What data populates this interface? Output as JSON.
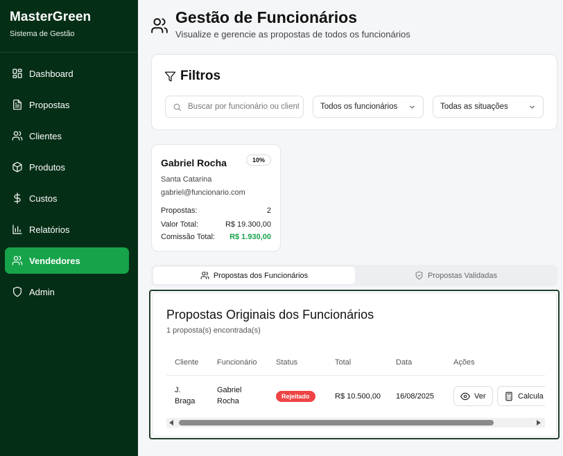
{
  "brand": {
    "title": "MasterGreen",
    "subtitle": "Sistema de Gestão"
  },
  "sidebar": {
    "items": [
      {
        "label": "Dashboard",
        "icon": "dashboard-icon",
        "active": false
      },
      {
        "label": "Propostas",
        "icon": "document-icon",
        "active": false
      },
      {
        "label": "Clientes",
        "icon": "users-icon",
        "active": false
      },
      {
        "label": "Produtos",
        "icon": "package-icon",
        "active": false
      },
      {
        "label": "Custos",
        "icon": "dollar-icon",
        "active": false
      },
      {
        "label": "Relatórios",
        "icon": "bar-chart-icon",
        "active": false
      },
      {
        "label": "Vendedores",
        "icon": "users-icon",
        "active": true
      },
      {
        "label": "Admin",
        "icon": "shield-icon",
        "active": false
      }
    ]
  },
  "header": {
    "title": "Gestão de Funcionários",
    "subtitle": "Visualize e gerencie as propostas de todos os funcionários"
  },
  "filters": {
    "title": "Filtros",
    "search_placeholder": "Buscar por funcionário ou cliente...",
    "employee_select": "Todos os funcionários",
    "status_select": "Todas as situações"
  },
  "employee": {
    "name": "Gabriel Rocha",
    "commission_rate": "10%",
    "region": "Santa Catarina",
    "email": "gabriel@funcionario.com",
    "proposals_label": "Propostas:",
    "proposals_value": "2",
    "total_label": "Valor Total:",
    "total_value": "R$ 19.300,00",
    "commission_label": "Comissão Total:",
    "commission_value": "R$ 1.930,00"
  },
  "tabs": [
    {
      "label": "Propostas dos Funcionários",
      "active": true
    },
    {
      "label": "Propostas Validadas",
      "active": false
    }
  ],
  "proposals": {
    "title": "Propostas Originais dos Funcionários",
    "count_text": "1 proposta(s) encontrada(s)",
    "columns": [
      "Cliente",
      "Funcionário",
      "Status",
      "Total",
      "Data",
      "Ações"
    ],
    "rows": [
      {
        "client_line1": "J.",
        "client_line2": "Braga",
        "employee_line1": "Gabriel",
        "employee_line2": "Rocha",
        "status": "Rejeitado",
        "total": "R$ 10.500,00",
        "date": "16/08/2025",
        "action_view": "Ver",
        "action_calc": "Calcula"
      }
    ]
  },
  "colors": {
    "sidebar_bg": "#052e16",
    "accent": "#16a34a",
    "rejected": "#ef4444"
  }
}
